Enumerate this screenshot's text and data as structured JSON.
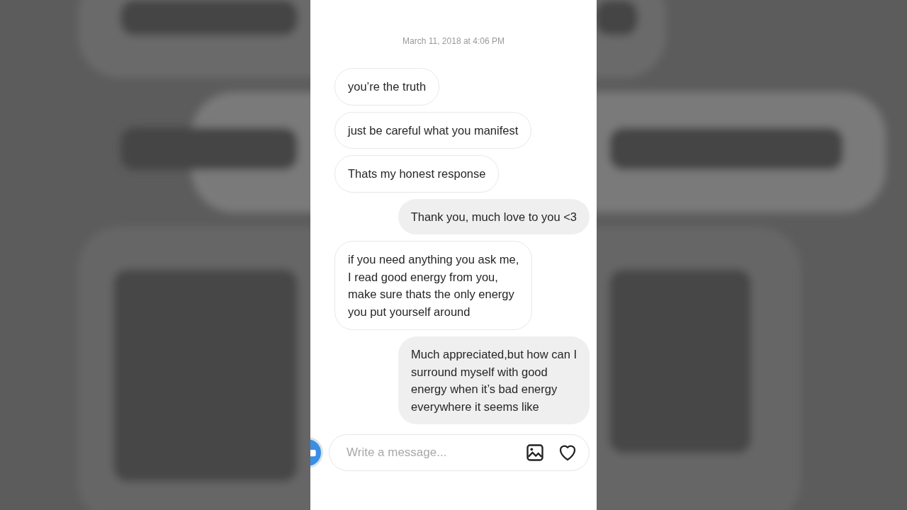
{
  "timestamp": "March 11, 2018 at 4:06 PM",
  "messages": [
    {
      "kind": "received",
      "lines": [
        "you’re the truth"
      ]
    },
    {
      "kind": "received",
      "lines": [
        "just be careful what you manifest"
      ]
    },
    {
      "kind": "received",
      "lines": [
        "Thats my honest response"
      ]
    },
    {
      "kind": "sent",
      "lines": [
        "Thank you, much love to you <3"
      ]
    },
    {
      "kind": "received",
      "lines": [
        "if you need anything you ask me,",
        "I read good energy from you,",
        "make sure thats the only energy",
        "you put yourself around"
      ]
    },
    {
      "kind": "sent",
      "lines": [
        "Much appreciated,but how can I",
        "surround myself with good",
        "energy when it’s bad energy",
        "everywhere it seems like"
      ]
    }
  ],
  "composer": {
    "placeholder": "Write a message..."
  }
}
